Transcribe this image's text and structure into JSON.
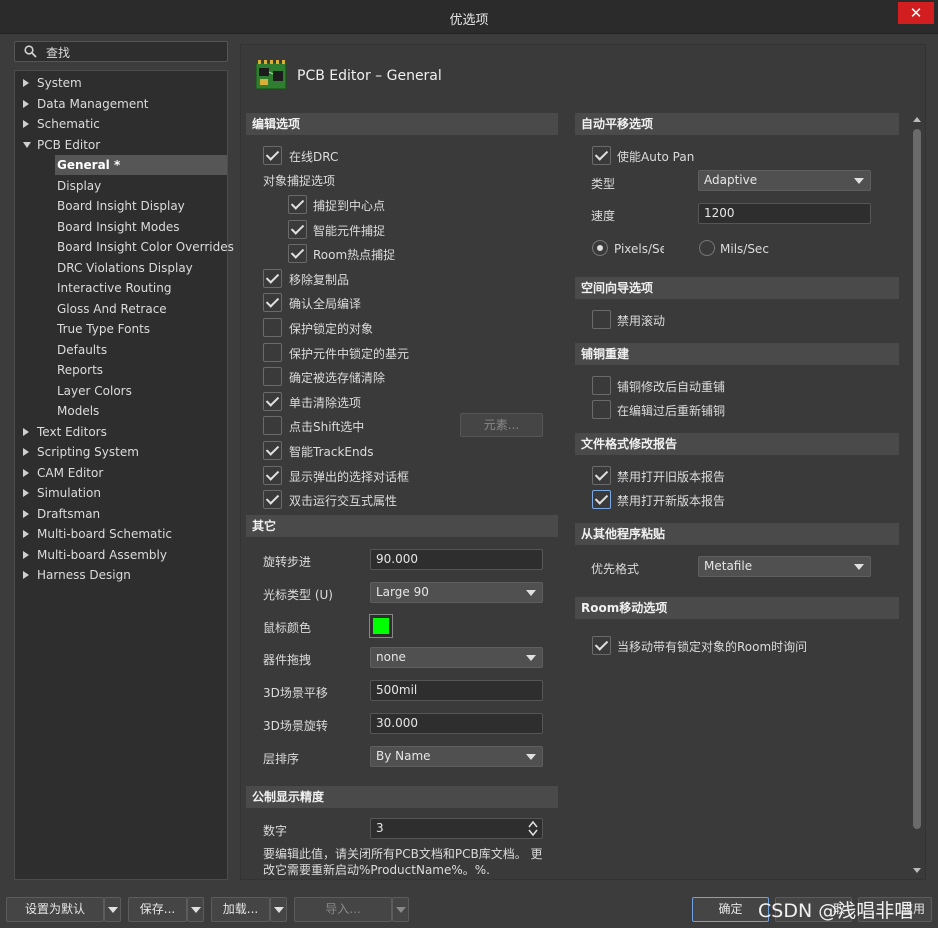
{
  "window": {
    "title": "优选项",
    "close_glyph": "✕"
  },
  "search": {
    "label": "查找",
    "icon": "search-icon"
  },
  "tree": [
    {
      "label": "System",
      "level": 0,
      "expanded": false
    },
    {
      "label": "Data Management",
      "level": 0,
      "expanded": false
    },
    {
      "label": "Schematic",
      "level": 0,
      "expanded": false
    },
    {
      "label": "PCB Editor",
      "level": 0,
      "expanded": true
    },
    {
      "label": "General *",
      "level": 1,
      "selected": true
    },
    {
      "label": "Display",
      "level": 1
    },
    {
      "label": "Board Insight Display",
      "level": 1
    },
    {
      "label": "Board Insight Modes",
      "level": 1
    },
    {
      "label": "Board Insight Color Overrides",
      "level": 1
    },
    {
      "label": "DRC Violations Display",
      "level": 1
    },
    {
      "label": "Interactive Routing",
      "level": 1
    },
    {
      "label": "Gloss And Retrace",
      "level": 1
    },
    {
      "label": "True Type Fonts",
      "level": 1
    },
    {
      "label": "Defaults",
      "level": 1
    },
    {
      "label": "Reports",
      "level": 1
    },
    {
      "label": "Layer Colors",
      "level": 1
    },
    {
      "label": "Models",
      "level": 1
    },
    {
      "label": "Text Editors",
      "level": 0,
      "expanded": false
    },
    {
      "label": "Scripting System",
      "level": 0,
      "expanded": false
    },
    {
      "label": "CAM Editor",
      "level": 0,
      "expanded": false
    },
    {
      "label": "Simulation",
      "level": 0,
      "expanded": false
    },
    {
      "label": "Draftsman",
      "level": 0,
      "expanded": false
    },
    {
      "label": "Multi-board Schematic",
      "level": 0,
      "expanded": false
    },
    {
      "label": "Multi-board Assembly",
      "level": 0,
      "expanded": false
    },
    {
      "label": "Harness Design",
      "level": 0,
      "expanded": false
    }
  ],
  "page": {
    "title": "PCB Editor – General",
    "icon": "pcb-board-icon"
  },
  "edit_options": {
    "header": "编辑选项",
    "online_drc": {
      "label": "在线DRC",
      "checked": true
    },
    "snap_group_label": "对象捕捉选项",
    "snap_center": {
      "label": "捕捉到中心点",
      "checked": true
    },
    "smart_component_snap": {
      "label": "智能元件捕捉",
      "checked": true
    },
    "room_hotspot_snap": {
      "label": "Room热点捕捉",
      "checked": true
    },
    "remove_duplicates": {
      "label": "移除复制品",
      "checked": true
    },
    "confirm_global_edit": {
      "label": "确认全局编译",
      "checked": true
    },
    "protect_locked": {
      "label": "保护锁定的对象",
      "checked": false
    },
    "protect_primitives": {
      "label": "保护元件中锁定的基元",
      "checked": false
    },
    "confirm_selection_clear": {
      "label": "确定被选存储清除",
      "checked": false
    },
    "click_clears_selection": {
      "label": "单击清除选项",
      "checked": true
    },
    "shift_click_select": {
      "label": "点击Shift选中",
      "checked": false
    },
    "primitives_button": "元素...",
    "smart_track_ends": {
      "label": "智能TrackEnds",
      "checked": true
    },
    "show_popup_dialog": {
      "label": "显示弹出的选择对话框",
      "checked": true
    },
    "dblclick_interactive": {
      "label": "双击运行交互式属性",
      "checked": true
    }
  },
  "other": {
    "header": "其它",
    "rotation_step": {
      "label": "旋转步进",
      "value": "90.000"
    },
    "cursor_type": {
      "label": "光标类型 (U)",
      "value": "Large 90"
    },
    "cursor_color": {
      "label": "鼠标颜色",
      "color": "#00ff00"
    },
    "component_drag": {
      "label": "器件拖拽",
      "value": "none"
    },
    "pan_3d": {
      "label": "3D场景平移",
      "value": "500mil"
    },
    "rotate_3d": {
      "label": "3D场景旋转",
      "value": "30.000"
    },
    "layer_order": {
      "label": "层排序",
      "value": "By Name"
    }
  },
  "metric_precision": {
    "header": "公制显示精度",
    "digits": {
      "label": "数字",
      "value": "3"
    },
    "note_line1": "要编辑此值，请关闭所有PCB文档和PCB库文档。 更",
    "note_line2": "改它需要重新启动%ProductName%。%."
  },
  "autopan": {
    "header": "自动平移选项",
    "enable": {
      "label": "使能Auto Pan",
      "checked": true
    },
    "type": {
      "label": "类型",
      "value": "Adaptive"
    },
    "speed": {
      "label": "速度",
      "value": "1200"
    },
    "unit_pixels": {
      "label": "Pixels/Sec",
      "selected": true
    },
    "unit_mils": {
      "label": "Mils/Sec",
      "selected": false
    }
  },
  "space_navigator": {
    "header": "空间向导选项",
    "disable_roll": {
      "label": "禁用滚动",
      "checked": false
    }
  },
  "polygon_rebuild": {
    "header": "铺铜重建",
    "repour_after_modify": {
      "label": "铺铜修改后自动重铺",
      "checked": false
    },
    "repour_after_edit": {
      "label": "在编辑过后重新铺铜",
      "checked": false
    }
  },
  "file_format_report": {
    "header": "文件格式修改报告",
    "disable_old": {
      "label": "禁用打开旧版本报告",
      "checked": true
    },
    "disable_new": {
      "label": "禁用打开新版本报告",
      "checked": true
    }
  },
  "paste_from_other": {
    "header": "从其他程序粘贴",
    "preferred_format": {
      "label": "优先格式",
      "value": "Metafile"
    }
  },
  "room_move": {
    "header": "Room移动选项",
    "ask_locked": {
      "label": "当移动带有锁定对象的Room时询问",
      "checked": true
    }
  },
  "footer": {
    "set_default": "设置为默认",
    "save": "保存...",
    "load": "加载...",
    "import": "导入...",
    "ok": "确定",
    "cancel": "取",
    "apply": "应用",
    "watermark": "CSDN @浅唱非唱"
  }
}
